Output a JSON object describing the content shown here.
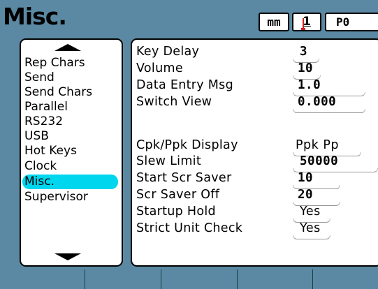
{
  "header": {
    "title": "Misc.",
    "units": "mm",
    "channel": "1",
    "part": "P0"
  },
  "menu": {
    "items": [
      {
        "label": "Rep Chars",
        "selected": false
      },
      {
        "label": "Send",
        "selected": false
      },
      {
        "label": "Send Chars",
        "selected": false
      },
      {
        "label": "Parallel",
        "selected": false
      },
      {
        "label": "RS232",
        "selected": false
      },
      {
        "label": "USB",
        "selected": false
      },
      {
        "label": "Hot Keys",
        "selected": false
      },
      {
        "label": "Clock",
        "selected": false
      },
      {
        "label": "Misc.",
        "selected": true
      },
      {
        "label": "Supervisor",
        "selected": false
      }
    ]
  },
  "settings": [
    {
      "label": "Key Delay",
      "value": "3"
    },
    {
      "label": "Volume",
      "value": "10"
    },
    {
      "label": "Data Entry Msg",
      "value": "1.0"
    },
    {
      "label": "Switch View",
      "value": "0.000"
    },
    {
      "label": "Cpk/Ppk Display",
      "value": "Ppk Pp"
    },
    {
      "label": "Slew Limit",
      "value": "50000"
    },
    {
      "label": "Start Scr Saver",
      "value": "10"
    },
    {
      "label": "Scr Saver Off",
      "value": "20"
    },
    {
      "label": "Startup Hold",
      "value": "Yes"
    },
    {
      "label": "Strict Unit Check",
      "value": "Yes"
    }
  ],
  "softkeys": [
    "",
    "",
    "",
    "",
    ""
  ],
  "colors": {
    "background": "#5b89a3",
    "selected": "#00d6ee",
    "channel_marker": "#d02020"
  }
}
